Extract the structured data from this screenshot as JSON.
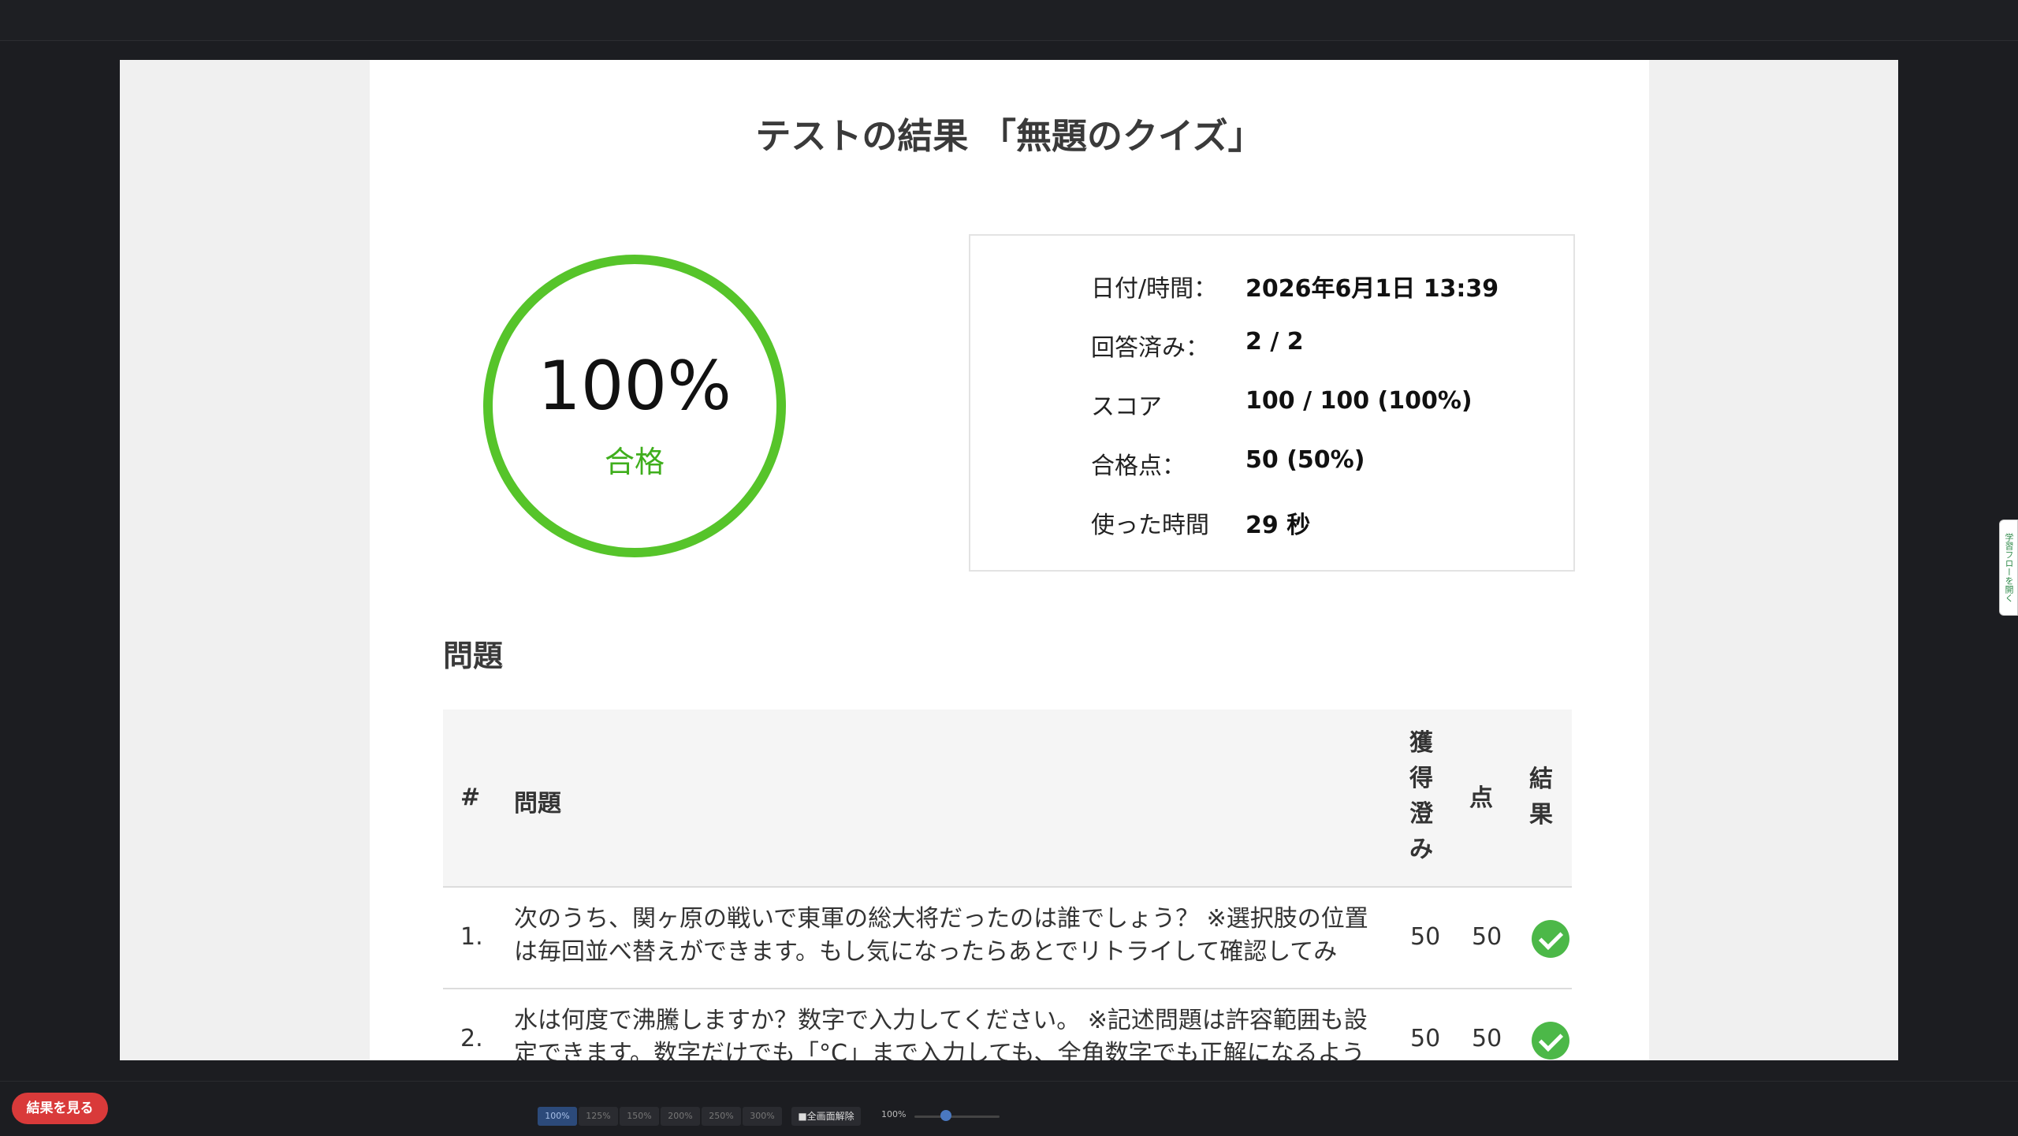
{
  "page": {
    "title": "テストの結果 「無題のクイズ」"
  },
  "summary": {
    "percent": "100%",
    "status": "合格",
    "ring_fill": 1.0,
    "accent_color": "#56c42a"
  },
  "info": [
    {
      "label": "日付/時間：",
      "value": "2026年6月1日 13:39"
    },
    {
      "label": "回答済み：",
      "value": "2 / 2"
    },
    {
      "label": "スコア",
      "value": "100 / 100 (100%)"
    },
    {
      "label": "合格点：",
      "value": "50 (50%)"
    },
    {
      "label": "使った時間",
      "value": "29 秒"
    }
  ],
  "questions": {
    "heading": "問題",
    "columns": {
      "num": "#",
      "question": "問題",
      "earned": "獲得澄み",
      "points": "点",
      "result": "結果"
    },
    "rows": [
      {
        "num": "1.",
        "text": "次のうち、関ヶ原の戦いで東軍の総大将だったのは誰でしょう？ ※選択肢の位置は毎回並べ替えができます。もし気になったらあとでリトライして確認してみ",
        "earned": "50",
        "points": "50",
        "result_icon": "check-circle-icon"
      },
      {
        "num": "2.",
        "text": "水は何度で沸騰しますか？数字で入力してください。 ※記述問題は許容範囲も設定できます。数字だけでも「°C」まで入力しても、全角数字でも正解になるよう",
        "earned": "50",
        "points": "50",
        "result_icon": "check-circle-icon"
      }
    ]
  },
  "side_tab": {
    "label": "学習フローを開く"
  },
  "footer": {
    "result_button": "結果を見る",
    "zoom_options": [
      "100%",
      "125%",
      "150%",
      "200%",
      "250%",
      "300%"
    ],
    "active_zoom": "100%",
    "fullscreen_button": "■全画面解除",
    "zoom_readout": "100%"
  }
}
